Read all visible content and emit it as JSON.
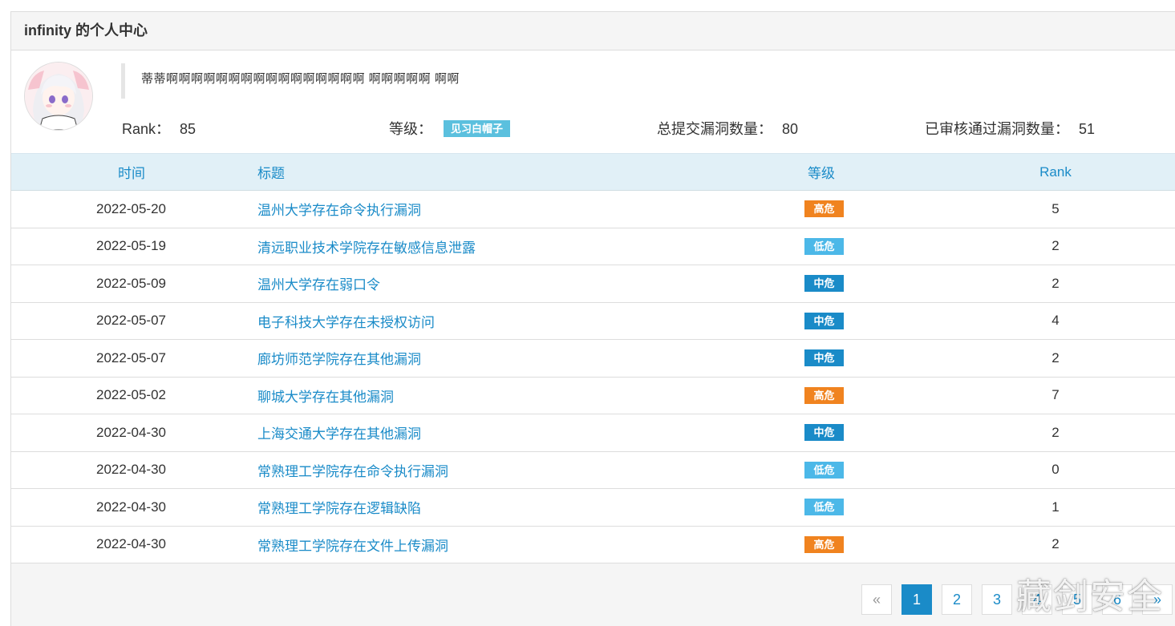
{
  "panel": {
    "title": "infinity 的个人中心"
  },
  "profile": {
    "motto": "蒂蒂啊啊啊啊啊啊啊啊啊啊啊啊啊啊啊啊 啊啊啊啊啊 啊啊",
    "rank_label": "Rank：",
    "rank_value": "85",
    "level_label": "等级：",
    "level_value": "见习白帽子",
    "submitted_label": "总提交漏洞数量：",
    "submitted_value": "80",
    "approved_label": "已审核通过漏洞数量：",
    "approved_value": "51"
  },
  "table": {
    "headers": {
      "time": "时间",
      "title": "标题",
      "level": "等级",
      "rank": "Rank"
    },
    "rows": [
      {
        "time": "2022-05-20",
        "title": "温州大学存在命令执行漏洞",
        "level": "高危",
        "rank": "5"
      },
      {
        "time": "2022-05-19",
        "title": "清远职业技术学院存在敏感信息泄露",
        "level": "低危",
        "rank": "2"
      },
      {
        "time": "2022-05-09",
        "title": "温州大学存在弱口令",
        "level": "中危",
        "rank": "2"
      },
      {
        "time": "2022-05-07",
        "title": "电子科技大学存在未授权访问",
        "level": "中危",
        "rank": "4"
      },
      {
        "time": "2022-05-07",
        "title": "廊坊师范学院存在其他漏洞",
        "level": "中危",
        "rank": "2"
      },
      {
        "time": "2022-05-02",
        "title": "聊城大学存在其他漏洞",
        "level": "高危",
        "rank": "7"
      },
      {
        "time": "2022-04-30",
        "title": "上海交通大学存在其他漏洞",
        "level": "中危",
        "rank": "2"
      },
      {
        "time": "2022-04-30",
        "title": "常熟理工学院存在命令执行漏洞",
        "level": "低危",
        "rank": "0"
      },
      {
        "time": "2022-04-30",
        "title": "常熟理工学院存在逻辑缺陷",
        "level": "低危",
        "rank": "1"
      },
      {
        "time": "2022-04-30",
        "title": "常熟理工学院存在文件上传漏洞",
        "level": "高危",
        "rank": "2"
      }
    ]
  },
  "severity_colors": {
    "高危": "#f0831f",
    "中危": "#1a8bc8",
    "低危": "#4cb8e8"
  },
  "pagination": {
    "prev": "«",
    "pages": [
      "1",
      "2",
      "3",
      "4",
      "5",
      "6"
    ],
    "next": "»",
    "active": "1"
  },
  "watermark": "藏剑安全"
}
